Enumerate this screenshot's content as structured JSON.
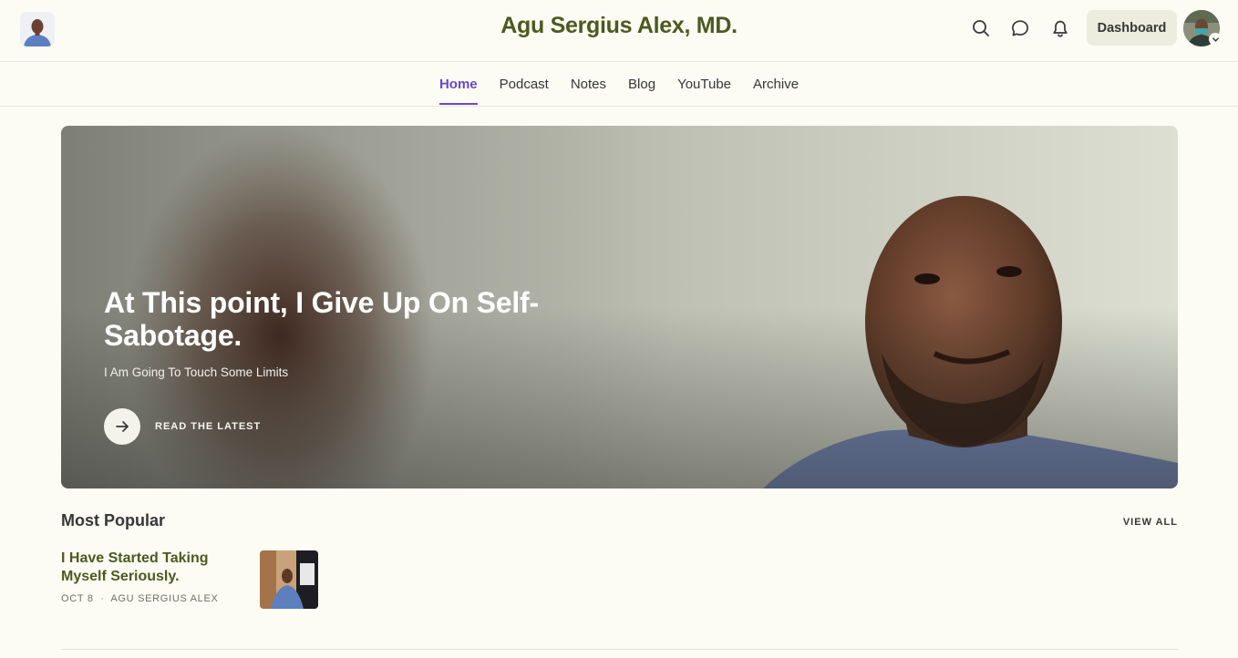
{
  "header": {
    "publication_title": "Agu Sergius Alex, MD.",
    "dashboard_label": "Dashboard",
    "icons": [
      "search-icon",
      "chat-icon",
      "bell-icon",
      "chevron-down-icon"
    ]
  },
  "nav": {
    "tabs": [
      {
        "label": "Home",
        "active": true
      },
      {
        "label": "Podcast",
        "active": false
      },
      {
        "label": "Notes",
        "active": false
      },
      {
        "label": "Blog",
        "active": false
      },
      {
        "label": "YouTube",
        "active": false
      },
      {
        "label": "Archive",
        "active": false
      }
    ]
  },
  "hero": {
    "title": "At This point, I Give Up On Self-Sabotage.",
    "subtitle": "I Am Going To Touch Some Limits",
    "cta_label": "READ THE LATEST",
    "cta_icon": "arrow-right-icon"
  },
  "most_popular": {
    "heading": "Most Popular",
    "view_all_label": "VIEW ALL",
    "posts": [
      {
        "title": "I Have Started Taking Myself Seriously.",
        "date": "OCT 8",
        "separator": "∙",
        "author": "AGU SERGIUS ALEX"
      }
    ]
  },
  "colors": {
    "accent": "#6b46d8",
    "brand_text": "#4c5a1f",
    "background": "#fcfcf4"
  }
}
